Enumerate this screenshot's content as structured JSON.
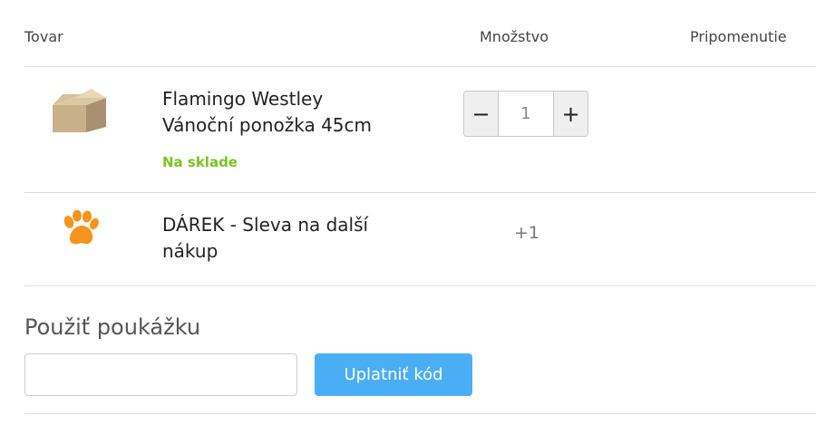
{
  "table": {
    "headers": {
      "product": "Tovar",
      "quantity": "Množstvo",
      "reminder": "Pripomenutie"
    },
    "rows": [
      {
        "name_line1": "Flamingo Westley",
        "name_line2": "Vánoční ponožka 45cm",
        "stock_status": "Na sklade",
        "quantity": "1",
        "image_icon": "box-icon"
      },
      {
        "name_line1": "DÁREK - Sleva na další",
        "name_line2": "nákup",
        "quantity": "+1",
        "image_icon": "paw-icon"
      }
    ]
  },
  "stepper": {
    "minus_label": "−",
    "plus_label": "+"
  },
  "voucher": {
    "title": "Použiť poukážku",
    "input_value": "",
    "apply_label": "Uplatniť kód"
  },
  "colors": {
    "stock_green": "#7cc322",
    "button_blue": "#4aaef5",
    "paw_orange": "#f7941d"
  }
}
